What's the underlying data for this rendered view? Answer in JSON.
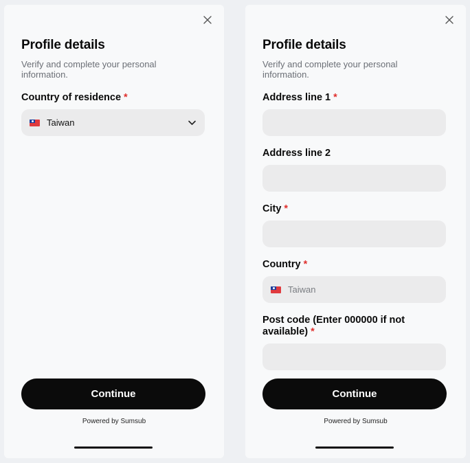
{
  "left_screen": {
    "title": "Profile details",
    "subtitle": "Verify and complete your personal information.",
    "country_label": "Country of residence",
    "required_mark": "*",
    "country_value": "Taiwan",
    "continue_label": "Continue",
    "powered_by": "Powered by Sumsub"
  },
  "right_screen": {
    "title": "Profile details",
    "subtitle": "Verify and complete your personal information.",
    "required_mark": "*",
    "fields": [
      {
        "label": "Address line 1",
        "required": true,
        "value": ""
      },
      {
        "label": "Address line 2",
        "required": false,
        "value": ""
      },
      {
        "label": "City",
        "required": true,
        "value": ""
      },
      {
        "label": "Country",
        "required": true,
        "value": "Taiwan"
      },
      {
        "label": "Post code (Enter 000000 if not available)",
        "required": true,
        "value": ""
      }
    ],
    "continue_label": "Continue",
    "powered_by": "Powered by Sumsub"
  },
  "icons": {
    "close": "close-icon",
    "chevron": "chevron-down-icon",
    "flag": "taiwan-flag-icon"
  },
  "colors": {
    "required": "#e0312e",
    "button": "#0b0b0b",
    "input_bg": "#ebebec"
  }
}
